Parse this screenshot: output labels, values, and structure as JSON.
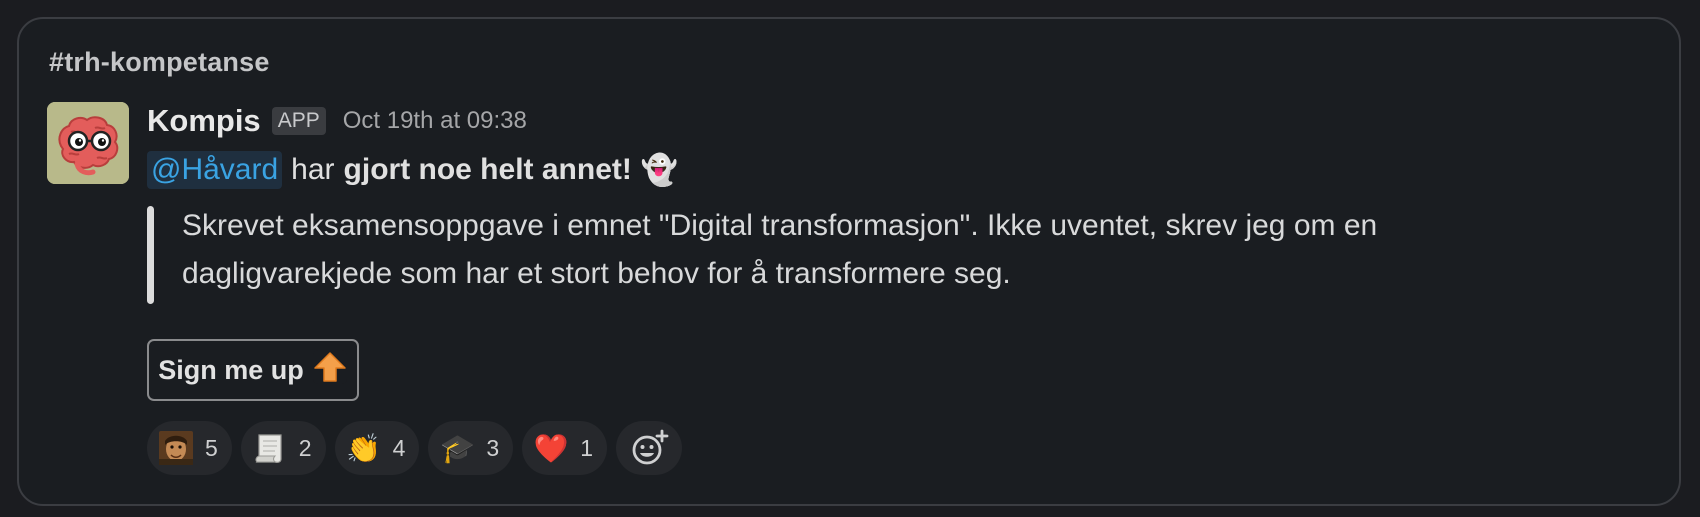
{
  "channel": {
    "name": "#trh-kompetanse"
  },
  "message": {
    "sender": "Kompis",
    "badge": "APP",
    "timestamp": "Oct 19th at 09:38",
    "mention": "@Håvard",
    "text_plain": "har",
    "text_bold": "gjort noe helt annet!",
    "emoji": "👻",
    "quote_line1": "Skrevet eksamensoppgave i emnet \"Digital transformasjon\". Ikke uventet, skrev jeg om en",
    "quote_line2": "dagligvarekjede som har et stort behov for å transformere seg."
  },
  "button": {
    "label": "Sign me up",
    "emoji": "⬆️"
  },
  "reactions": [
    {
      "icon": "custom-portrait-icon",
      "count": "5"
    },
    {
      "icon": "paper-scroll-icon",
      "count": "2"
    },
    {
      "emoji": "👏",
      "count": "4"
    },
    {
      "emoji": "🎓",
      "count": "3"
    },
    {
      "emoji": "❤️",
      "count": "1"
    }
  ],
  "add_reaction": {
    "icon": "add-reaction-icon"
  },
  "avatar": {
    "icon": "brain-with-glasses-icon",
    "bg": "#b8b98a",
    "brain": "#e35d5b"
  },
  "colors": {
    "mention": "#3aa3e3",
    "card_bg": "#1a1d21",
    "border": "#3b3d42"
  }
}
